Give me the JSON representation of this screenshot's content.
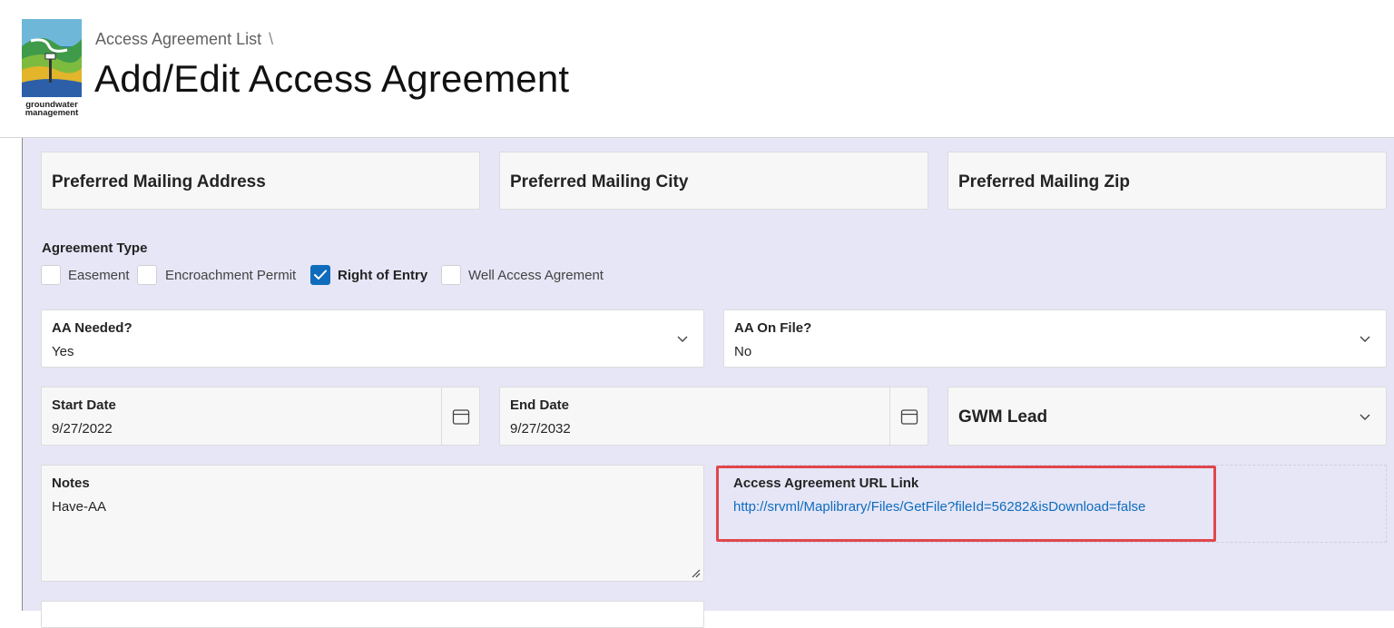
{
  "header": {
    "breadcrumb_label": "Access Agreement List",
    "breadcrumb_separator": "\\",
    "title": "Add/Edit Access Agreement",
    "logo_text": "groundwater management"
  },
  "mailing": {
    "address_label": "Preferred Mailing Address",
    "city_label": "Preferred Mailing City",
    "zip_label": "Preferred Mailing Zip"
  },
  "agreement_type": {
    "title": "Agreement Type",
    "options": [
      {
        "label": "Easement",
        "checked": false
      },
      {
        "label": "Encroachment Permit",
        "checked": false
      },
      {
        "label": "Right of Entry",
        "checked": true
      },
      {
        "label": "Well Access Agrement",
        "checked": false
      }
    ]
  },
  "aa_needed": {
    "label": "AA Needed?",
    "value": "Yes"
  },
  "aa_on_file": {
    "label": "AA On File?",
    "value": "No"
  },
  "start_date": {
    "label": "Start Date",
    "value": "9/27/2022"
  },
  "end_date": {
    "label": "End Date",
    "value": "9/27/2032"
  },
  "gwm_lead": {
    "label": "GWM Lead"
  },
  "notes": {
    "label": "Notes",
    "value": "Have-AA"
  },
  "url": {
    "label": "Access Agreement URL Link",
    "link": "http://srvml/Maplibrary/Files/GetFile?fileId=56282&isDownload=false"
  },
  "colors": {
    "accent": "#0f6cbd",
    "panel_background": "#e6e6f7",
    "highlight_border": "#e0474c"
  },
  "icons": [
    "groundwater-logo",
    "chevron-down-icon",
    "calendar-icon",
    "checkmark-icon",
    "resize-grip-icon"
  ]
}
